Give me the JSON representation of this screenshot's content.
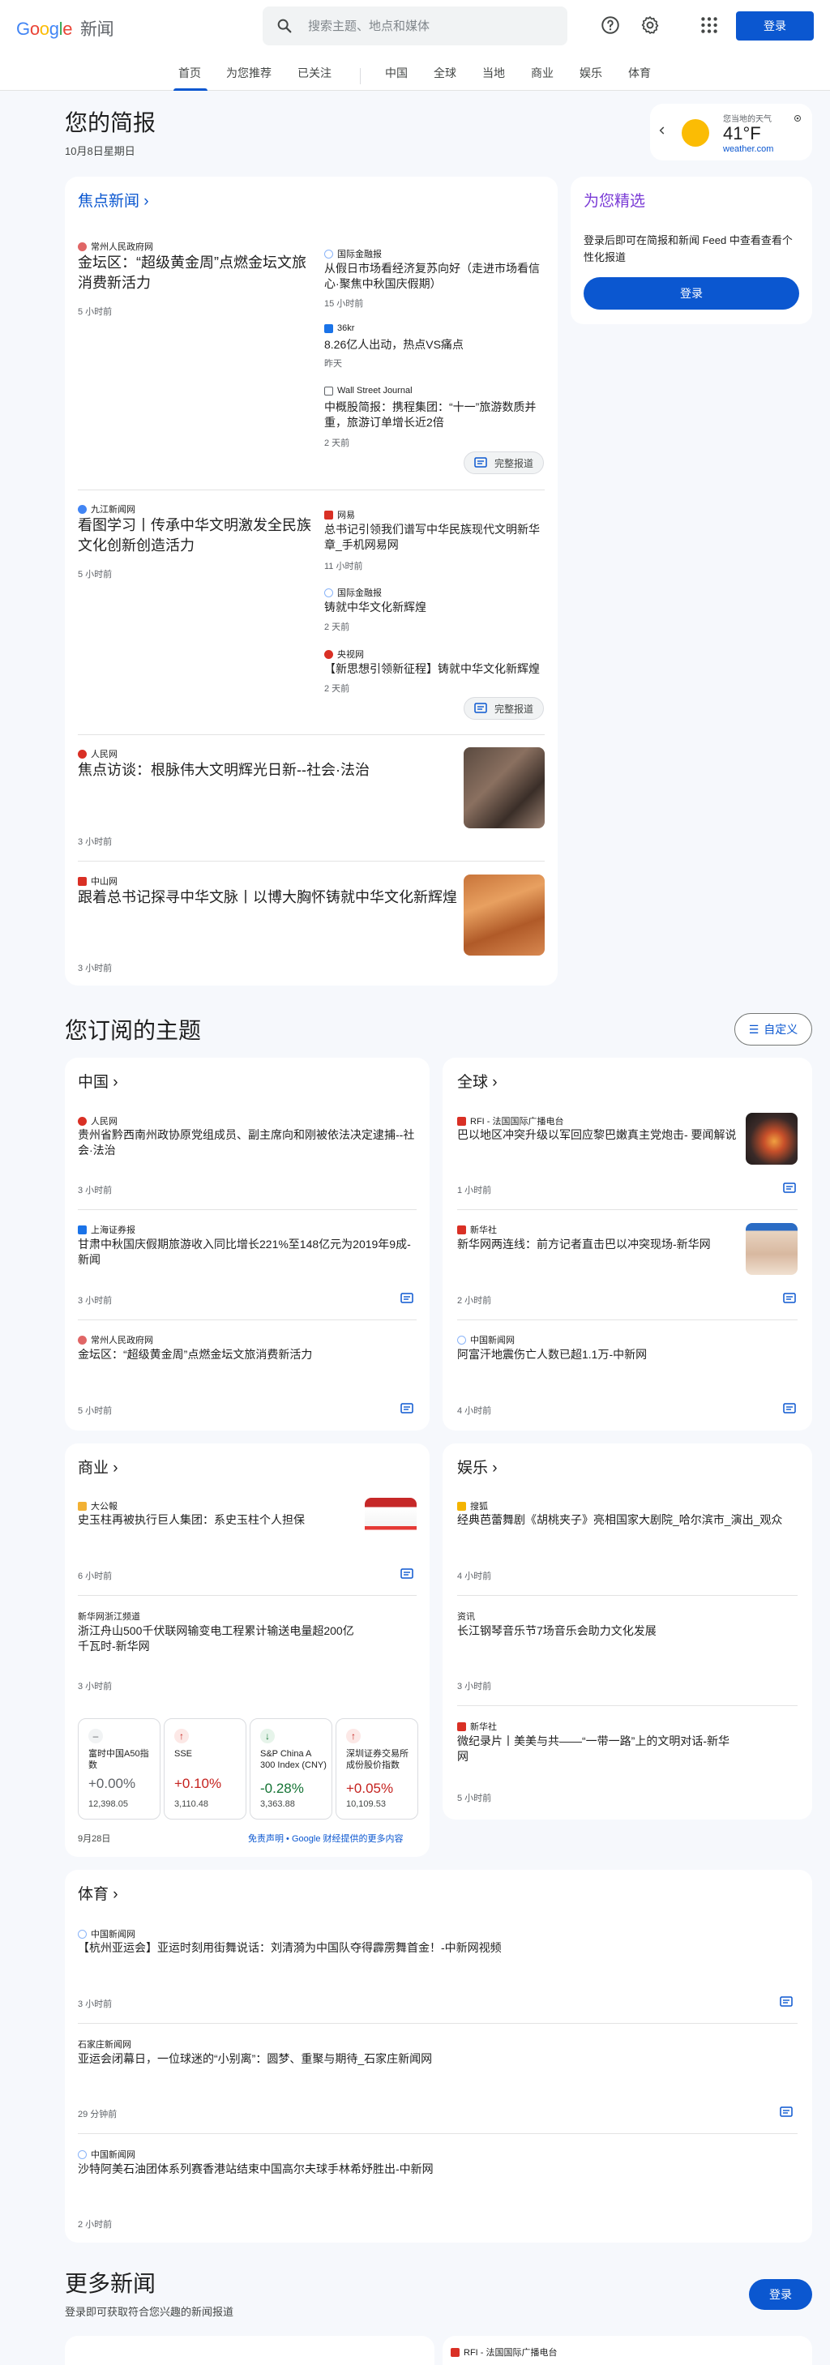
{
  "header": {
    "logo_google": "Google",
    "logo_news": "新闻",
    "search_placeholder": "搜索主题、地点和媒体",
    "sign_in": "登录",
    "icons": [
      "help-icon",
      "settings-icon",
      "apps-icon",
      "search-icon"
    ]
  },
  "nav": {
    "tabs": [
      "首页",
      "为您推荐",
      "已关注",
      "中国",
      "全球",
      "当地",
      "商业",
      "娱乐",
      "体育"
    ],
    "active": "首页"
  },
  "briefing": {
    "title": "您的简报",
    "date": "10月8日星期日",
    "weather": {
      "caption": "您当地的天气",
      "temp": "41°F",
      "source": "weather.com"
    }
  },
  "top_stories": {
    "title": "焦点新闻",
    "full_coverage": "完整报道",
    "clusters": [
      {
        "main": {
          "source": "常州人民政府网",
          "headline": "金坛区：“超级黄金周”点燃金坛文旅消费新活力",
          "time": "5 小时前"
        },
        "related": [
          {
            "source": "国际金融报",
            "headline": "从假日市场看经济复苏向好（走进市场看信心·聚焦中秋国庆假期）",
            "time": "15 小时前"
          },
          {
            "source": "36kr",
            "headline": "8.26亿人出动，热点VS痛点",
            "time": "昨天"
          },
          {
            "source": "Wall Street Journal",
            "headline": "中概股简报：携程集团：“十一”旅游数质并重，旅游订单增长近2倍",
            "time": "2 天前"
          }
        ]
      },
      {
        "main": {
          "source": "九江新闻网",
          "headline": "看图学习丨传承中华文明激发全民族文化创新创造活力",
          "time": "5 小时前"
        },
        "related": [
          {
            "source": "网易",
            "headline": "总书记引领我们谱写中华民族现代文明新华章_手机网易网",
            "time": "11 小时前"
          },
          {
            "source": "国际金融报",
            "headline": "铸就中华文化新辉煌",
            "time": "2 天前"
          },
          {
            "source": "央视网",
            "headline": "【新思想引领新征程】铸就中华文化新辉煌",
            "time": "2 天前"
          }
        ]
      }
    ],
    "singles": [
      {
        "source": "人民网",
        "headline": "焦点访谈：根脉伟大文明辉光日新--社会·法治",
        "time": "3 小时前"
      },
      {
        "source": "中山网",
        "headline": "跟着总书记探寻中华文脉丨以博大胸怀铸就中华文化新辉煌",
        "time": "3 小时前"
      }
    ]
  },
  "for_you": {
    "title": "为您精选",
    "text": "登录后即可在简报和新闻 Feed 中查看查看个性化报道",
    "button": "登录"
  },
  "topics": {
    "title": "您订阅的主题",
    "customize": "自定义",
    "china": {
      "title": "中国",
      "items": [
        {
          "source": "人民网",
          "headline": "贵州省黔西南州政协原党组成员、副主席向和刚被依法决定逮捕--社会·法治",
          "time": "3 小时前"
        },
        {
          "source": "上海证券报",
          "headline": "甘肃中秋国庆假期旅游收入同比增长221%至148亿元为2019年9成-新闻",
          "time": "3 小时前"
        },
        {
          "source": "常州人民政府网",
          "headline": "金坛区：“超级黄金周”点燃金坛文旅消费新活力",
          "time": "5 小时前"
        }
      ]
    },
    "world": {
      "title": "全球",
      "items": [
        {
          "source": "RFI - 法国国际广播电台",
          "headline": "巴以地区冲突升级以军回应黎巴嫩真主党炮击- 要闻解说",
          "time": "1 小时前"
        },
        {
          "source": "新华社",
          "headline": "新华网两连线：前方记者直击巴以冲突现场-新华网",
          "time": "2 小时前"
        },
        {
          "source": "中国新闻网",
          "headline": "阿富汗地震伤亡人数已超1.1万-中新网",
          "time": "4 小时前"
        }
      ]
    },
    "business": {
      "title": "商业",
      "items": [
        {
          "source": "大公報",
          "headline": "史玉柱再被执行巨人集团：系史玉柱个人担保",
          "time": "6 小时前"
        },
        {
          "source": "新华网浙江频道",
          "headline": "浙江舟山500千伏联网输变电工程累计输送电量超200亿千瓦时-新华网",
          "time": "3 小时前"
        }
      ],
      "stocks": [
        {
          "name": "富时中国A50指数",
          "change": "+0.00%",
          "value": "12,398.05",
          "dir": "flat"
        },
        {
          "name": "SSE",
          "change": "+0.10%",
          "value": "3,110.48",
          "dir": "up"
        },
        {
          "name": "S&P China A 300 Index (CNY)",
          "change": "-0.28%",
          "value": "3,363.88",
          "dir": "down"
        },
        {
          "name": "深圳证券交易所成份股价指数",
          "change": "+0.05%",
          "value": "10,109.53",
          "dir": "up"
        }
      ],
      "date": "9月28日",
      "disclaimer": "免责声明 • Google 财经提供的更多内容"
    },
    "entertainment": {
      "title": "娱乐",
      "items": [
        {
          "source": "搜狐",
          "headline": "经典芭蕾舞剧《胡桃夹子》亮相国家大剧院_哈尔滨市_演出_观众",
          "time": "4 小时前"
        },
        {
          "source": "资讯",
          "headline": "长江钢琴音乐节7场音乐会助力文化发展",
          "time": "3 小时前"
        },
        {
          "source": "新华社",
          "headline": "微纪录片丨美美与共——“一带一路”上的文明对话-新华网",
          "time": "5 小时前"
        }
      ]
    },
    "sports": {
      "title": "体育",
      "items": [
        {
          "source": "中国新闻网",
          "headline": "【杭州亚运会】亚运时刻用街舞说话：刘清漪为中国队夺得霹雳舞首金！-中新网视频",
          "time": "3 小时前"
        },
        {
          "source": "石家庄新闻网",
          "headline": "亚运会闭幕日，一位球迷的“小别离”：圆梦、重聚与期待_石家庄新闻网",
          "time": "29 分钟前"
        },
        {
          "source": "中国新闻网",
          "headline": "沙特阿美石油团体系列赛香港站结束中国高尔夫球手林希妤胜出-中新网",
          "time": "2 小时前"
        }
      ]
    }
  },
  "more_news": {
    "title": "更多新闻",
    "subtitle": "登录即可获取符合您兴趣的新闻报道",
    "button": "登录",
    "peek_source": "RFI - 法国国际广播电台"
  },
  "colors": {
    "accent": "#0b57d0",
    "up": "#c5221f",
    "down": "#137333",
    "bg": "#f6f8fc"
  }
}
